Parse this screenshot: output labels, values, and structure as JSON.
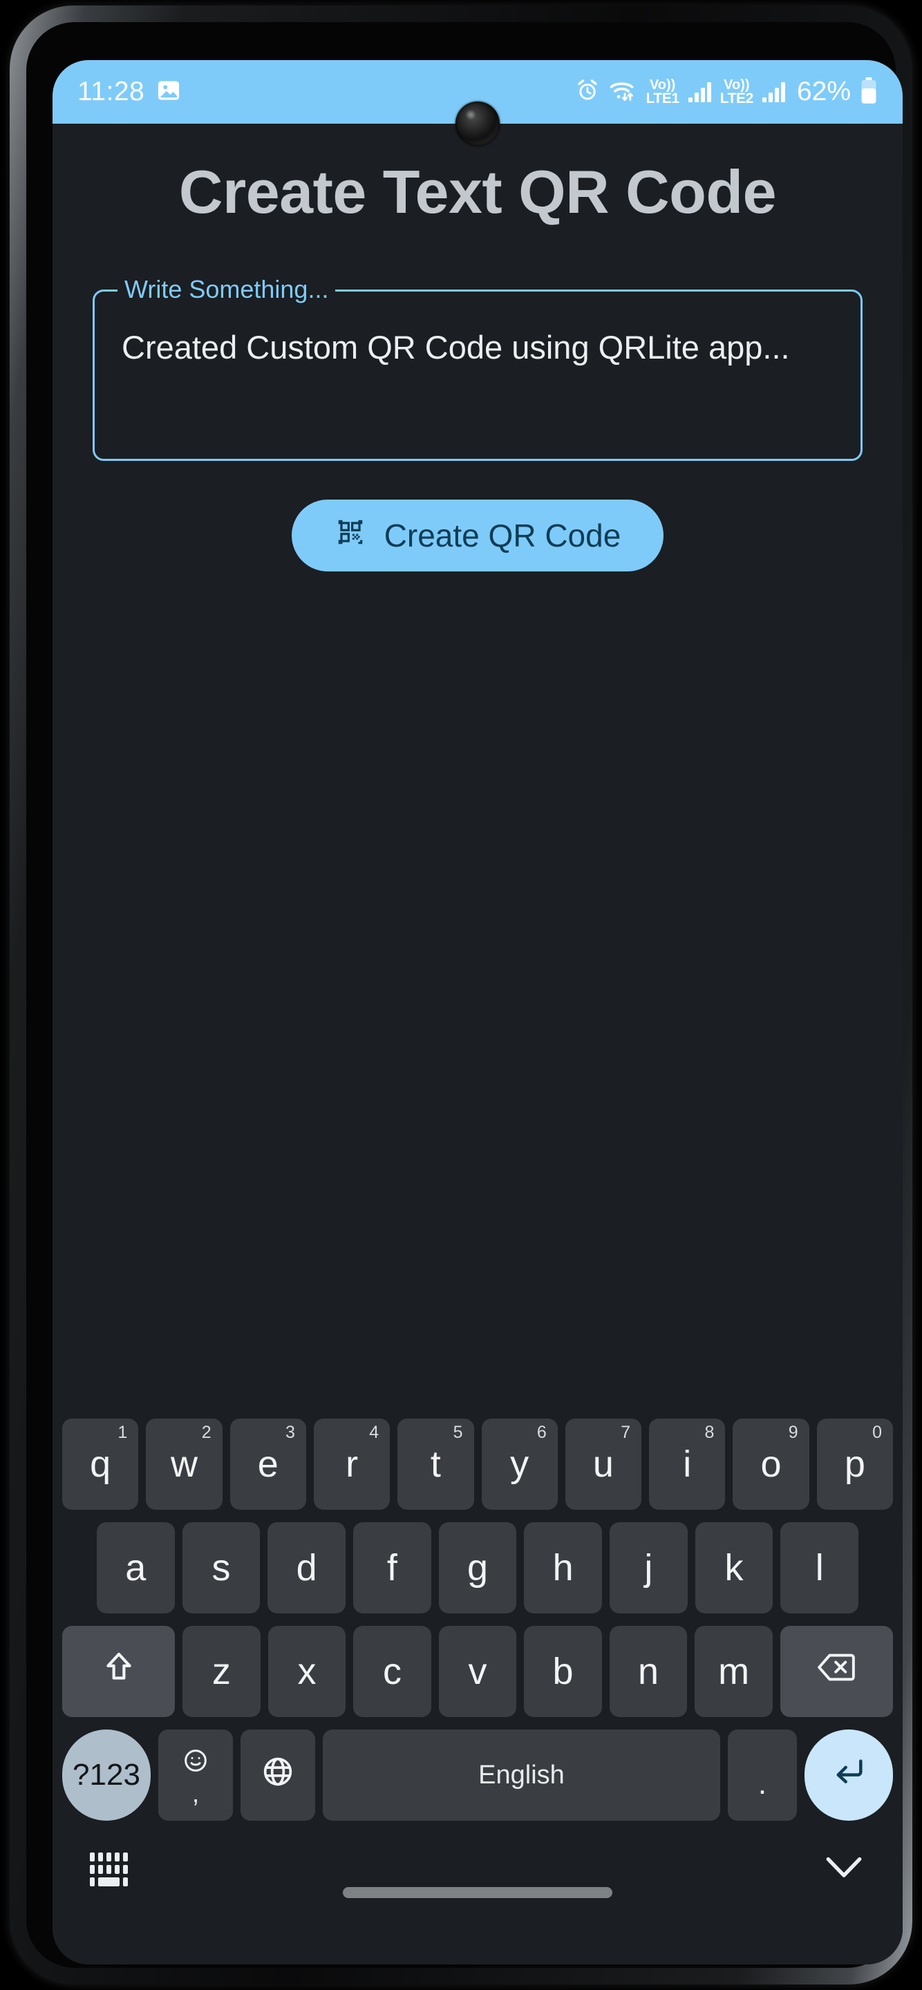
{
  "status_bar": {
    "time": "11:28",
    "battery_percent": "62%",
    "icons": {
      "photo": "photo-icon",
      "alarm": "alarm-icon",
      "wifi": "wifi-icon",
      "volte1_top": "Vo))",
      "volte1_bottom": "LTE1",
      "volte2_top": "Vo))",
      "volte2_bottom": "LTE2"
    },
    "background_color": "#7ecbfa"
  },
  "app": {
    "title": "Create Text QR Code",
    "text_field": {
      "label": "Write Something...",
      "value": "Created Custom QR Code using QRLite app...",
      "placeholder": "Write Something...",
      "accent_color": "#7ecbfa"
    },
    "create_button": {
      "label": "Create QR Code",
      "icon": "qr-code-icon",
      "background_color": "#7ecbfa",
      "text_color": "#0f3d55"
    },
    "background_color": "#1b1e22"
  },
  "keyboard": {
    "row1": [
      {
        "key": "q",
        "num": "1"
      },
      {
        "key": "w",
        "num": "2"
      },
      {
        "key": "e",
        "num": "3"
      },
      {
        "key": "r",
        "num": "4"
      },
      {
        "key": "t",
        "num": "5"
      },
      {
        "key": "y",
        "num": "6"
      },
      {
        "key": "u",
        "num": "7"
      },
      {
        "key": "i",
        "num": "8"
      },
      {
        "key": "o",
        "num": "9"
      },
      {
        "key": "p",
        "num": "0"
      }
    ],
    "row2": [
      {
        "key": "a"
      },
      {
        "key": "s"
      },
      {
        "key": "d"
      },
      {
        "key": "f"
      },
      {
        "key": "g"
      },
      {
        "key": "h"
      },
      {
        "key": "j"
      },
      {
        "key": "k"
      },
      {
        "key": "l"
      }
    ],
    "row3": [
      {
        "key": "z"
      },
      {
        "key": "x"
      },
      {
        "key": "c"
      },
      {
        "key": "v"
      },
      {
        "key": "b"
      },
      {
        "key": "n"
      },
      {
        "key": "m"
      }
    ],
    "shift_label": "shift-icon",
    "backspace_label": "backspace-icon",
    "bottom_row": {
      "symbols": "?123",
      "emoji_top": "☺",
      "emoji_bottom": ",",
      "globe": "globe-icon",
      "space": "English",
      "period": ".",
      "enter": "enter-icon"
    },
    "nav": {
      "switch_keyboard": "keyboard-switch-icon",
      "hide_keyboard": "chevron-down-icon"
    },
    "key_color": "#3a3d42",
    "enter_color": "#c9e6fb",
    "symbols_color": "#aebecb"
  }
}
